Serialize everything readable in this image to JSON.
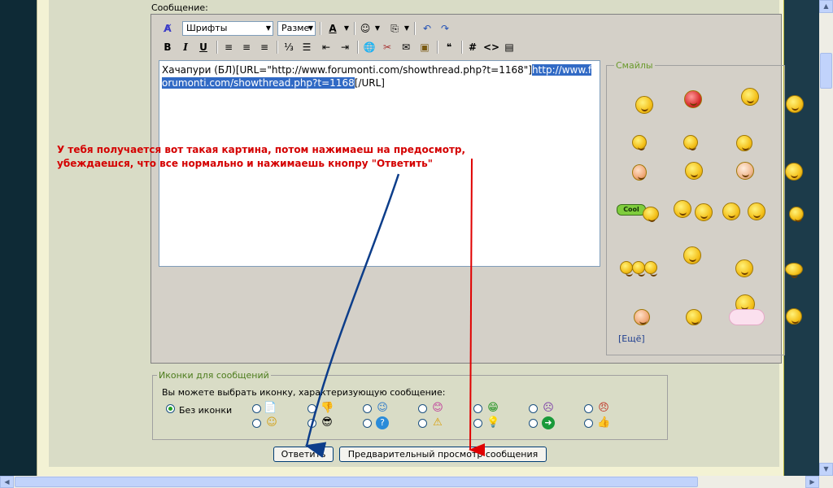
{
  "editor": {
    "label": "Сообщение:",
    "font_select": "Шрифты",
    "size_select": "Разме",
    "text_before": "Хачапури (БЛ)[URL=\"http://www.forumonti.com/showthread.php?t=1168\"]",
    "text_selected": "http://www.forumonti.com/showthread.php?t=1168",
    "text_after": "[/URL]",
    "toolbar_buttons": [
      "B",
      "I",
      "U",
      "#",
      "<>"
    ]
  },
  "smiles": {
    "legend": "Смайлы",
    "more_link": "[Ещё]",
    "cool_label": "Cool"
  },
  "annotation": {
    "line1": "У тебя получается вот такая картина, потом нажимаеш на предосмотр,",
    "line2": "убеждаешся, что все нормально и нажимаешь кнопру \"Ответить\""
  },
  "icons": {
    "legend": "Иконки для сообщений",
    "description": "Вы можете выбрать иконку, характеризующую сообщение:",
    "no_icon_label": "Без иконки"
  },
  "buttons": {
    "reply": "Ответить",
    "preview": "Предварительный просмотр сообщения"
  },
  "colors": {
    "annotation": "#d40000",
    "arrow_blue": "#0c3d8a",
    "arrow_red": "#e00000",
    "selection": "#316ac5"
  }
}
